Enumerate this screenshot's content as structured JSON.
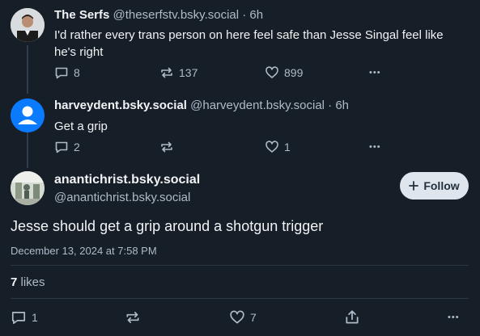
{
  "post1": {
    "display_name": "The Serfs",
    "handle": "@theserfstv.bsky.social",
    "time": "· 6h",
    "text": "I'd rather every trans person on here feel safe than Jesse Singal feel like he's right",
    "replies": "8",
    "reposts": "137",
    "likes": "899",
    "more": "•••"
  },
  "post2": {
    "display_name": "harveydent.bsky.social",
    "handle": "@harveydent.bsky.social",
    "time": "· 6h",
    "text": "Get a grip",
    "replies": "2",
    "reposts": "",
    "likes": "1",
    "more": "•••"
  },
  "main_post": {
    "display_name": "anantichrist.bsky.social",
    "handle": "@anantichrist.bsky.social",
    "follow_label": "Follow",
    "text": "Jesse should get a grip around a shotgun trigger",
    "timestamp": "December 13, 2024 at 7:58 PM",
    "likes_count": "7",
    "likes_label": "likes",
    "replies": "1",
    "reposts": "",
    "likes": "7",
    "more": "•••"
  },
  "colors": {
    "background": "#161e27",
    "text": "#f1f3f5",
    "muted": "#aebbc9",
    "default_avatar": "#0a7aff"
  },
  "icons": [
    "reply-icon",
    "repost-icon",
    "like-icon",
    "share-icon",
    "more-icon",
    "plus-icon"
  ]
}
